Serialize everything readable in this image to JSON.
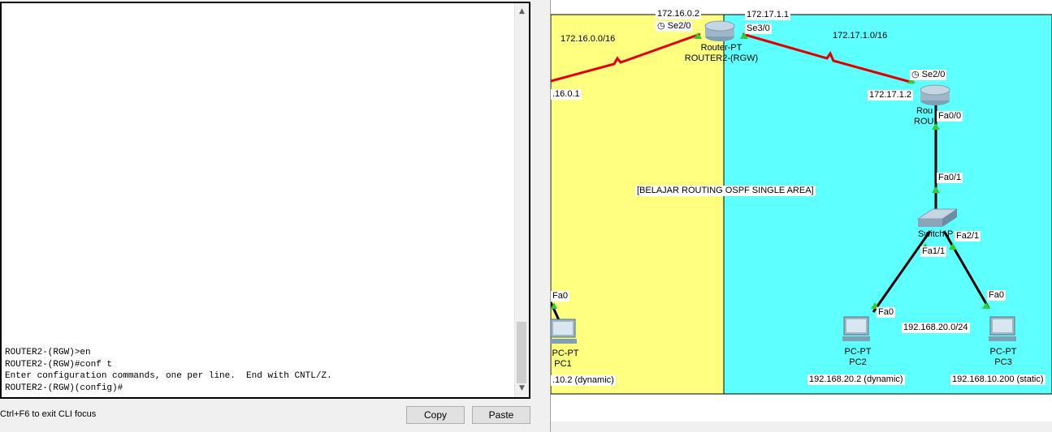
{
  "cli": {
    "lines": [
      "ROUTER2-(RGW)>en",
      "ROUTER2-(RGW)#conf t",
      "Enter configuration commands, one per line.  End with CNTL/Z.",
      "ROUTER2-(RGW)(config)#"
    ],
    "hint": "Ctrl+F6 to exit CLI focus",
    "copy_label": "Copy",
    "paste_label": "Paste",
    "scroll_up_icon": "chevron-up-icon",
    "scroll_down_icon": "chevron-down-icon"
  },
  "topology": {
    "colors": {
      "yellow_area": "#ffff80",
      "cyan_area": "#5effff",
      "serial_link": "#e00000",
      "ethernet_link": "#000000",
      "port_up": "#33cc33"
    },
    "networks": {
      "left_serial": "172.16.0.0/16",
      "right_serial": "172.17.1.0/16",
      "lan": "192.168.20.0/24"
    },
    "title": "[BELAJAR ROUTING OSPF SINGLE AREA]",
    "router2": {
      "type": "Router-PT",
      "name": "ROUTER2-(RGW)",
      "ip_left": "172.16.0.2",
      "port_left": "Se2/0",
      "ip_right": "172.17.1.1",
      "port_right": "Se3/0"
    },
    "router3": {
      "type_partial": "Rou",
      "name_partial": "ROU",
      "ip": "172.17.1.2",
      "port_serial": "Se2/0",
      "port_fast": "Fa0/0"
    },
    "switch": {
      "type_partial": "Switch-P",
      "port_up": "Fa0/1",
      "port_left": "Fa1/1",
      "port_right": "Fa2/1"
    },
    "left_ip_partial": ".16.0.1",
    "pc1": {
      "type": "PC-PT",
      "name": "PC1",
      "port": "Fa0",
      "ip_partial": ".10.2 (dynamic)"
    },
    "pc2": {
      "type": "PC-PT",
      "name": "PC2",
      "port": "Fa0",
      "ip": "192.168.20.2 (dynamic)"
    },
    "pc3": {
      "type": "PC-PT",
      "name": "PC3",
      "port": "Fa0",
      "ip": "192.168.10.200 (static)"
    }
  }
}
